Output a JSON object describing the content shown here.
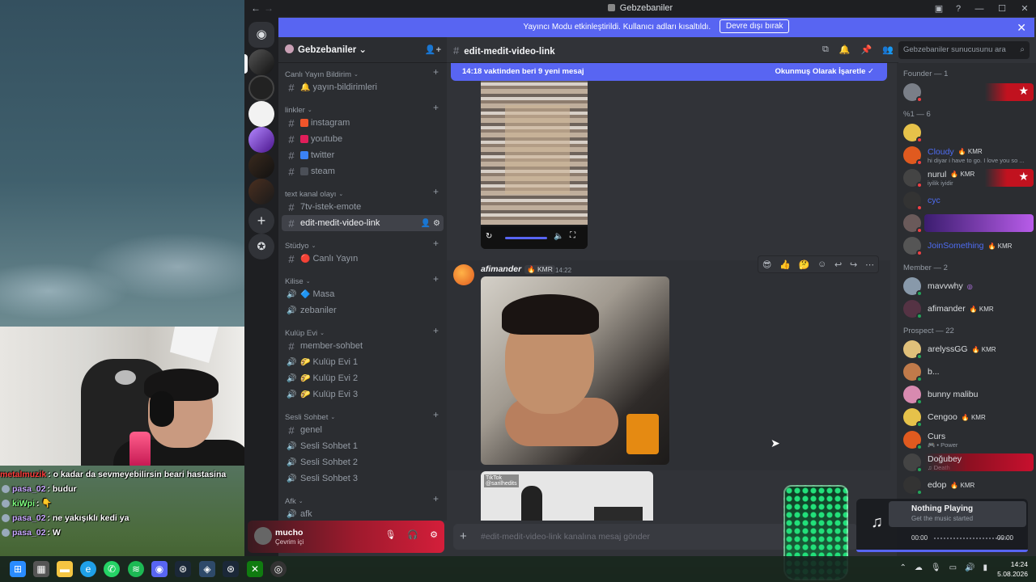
{
  "window": {
    "title": "Gebzebaniler"
  },
  "banner": {
    "text": "Yayıncı Modu etkinleştirildi. Kullanıcı adları kısaltıldı.",
    "button": "Devre dışı bırak"
  },
  "server": {
    "name": "Gebzebaniler",
    "categories": [
      {
        "name": "Canlı Yayın Bildirim",
        "channels": [
          {
            "type": "text",
            "emoji": "🔔",
            "label": "yayın-bildirimleri"
          }
        ]
      },
      {
        "name": "linkler",
        "channels": [
          {
            "type": "text",
            "square": "#f0552b",
            "label": "instagram"
          },
          {
            "type": "text",
            "square": "#e01e5a",
            "label": "youtube"
          },
          {
            "type": "text",
            "square": "#3b82f6",
            "label": "twitter"
          },
          {
            "type": "text",
            "square": "#4b4f57",
            "label": "steam"
          }
        ]
      },
      {
        "name": "text kanal olayı",
        "channels": [
          {
            "type": "text",
            "label": "7tv-istek-emote"
          },
          {
            "type": "text",
            "label": "edit-medit-video-link",
            "active": true
          }
        ]
      },
      {
        "name": "Stüdyo",
        "channels": [
          {
            "type": "text",
            "emoji": "🔴",
            "label": "Canlı Yayın"
          }
        ]
      },
      {
        "name": "Kilise",
        "channels": [
          {
            "type": "voice",
            "emoji": "🔷",
            "label": "Masa"
          },
          {
            "type": "voice",
            "label": "zebaniler"
          }
        ]
      },
      {
        "name": "Kulüp Evi",
        "channels": [
          {
            "type": "text",
            "label": "member-sohbet"
          },
          {
            "type": "voice",
            "emoji": "🌮",
            "label": "Kulüp Evi 1"
          },
          {
            "type": "voice",
            "emoji": "🌮",
            "label": "Kulüp Evi 2"
          },
          {
            "type": "voice",
            "emoji": "🌮",
            "label": "Kulüp Evi 3"
          }
        ]
      },
      {
        "name": "Sesli Sohbet",
        "channels": [
          {
            "type": "text",
            "label": "genel"
          },
          {
            "type": "voice",
            "label": "Sesli Sohbet 1"
          },
          {
            "type": "voice",
            "label": "Sesli Sohbet 2"
          },
          {
            "type": "voice",
            "label": "Sesli Sohbet 3"
          }
        ]
      },
      {
        "name": "Afk",
        "channels": [
          {
            "type": "voice",
            "label": "afk"
          }
        ]
      }
    ]
  },
  "channel": {
    "name": "edit-medit-video-link"
  },
  "search": {
    "placeholder": "Gebzebaniler sunucusunu ara"
  },
  "new_messages": {
    "text": "14:18 vaktinden beri 9 yeni mesaj",
    "action": "Okunmuş Olarak İşaretle"
  },
  "message": {
    "author": "afimander",
    "tag": "KMR",
    "time": "14:22"
  },
  "reactions": [
    "😎",
    "👍",
    "🤔"
  ],
  "tiktok": {
    "logo": "TikTok",
    "handle": "@sarilhedits"
  },
  "input": {
    "placeholder": "#edit-medit-video-link kanalına mesaj gönder"
  },
  "user": {
    "name": "mucho",
    "status": "Çevrim içi"
  },
  "members": {
    "groups": [
      {
        "label": "Founder — 1",
        "items": [
          {
            "name": "",
            "flag": true
          }
        ]
      },
      {
        "label": "%1 — 6",
        "items": [
          {
            "name": "",
            "blue": true
          },
          {
            "name": "Cloudy",
            "tag": "KMR",
            "sub": "hi diyar i have to go. I love you so ...",
            "blue": true
          },
          {
            "name": "nurul",
            "tag": "KMR",
            "sub": "iyilik iyidir",
            "flag": true
          },
          {
            "name": "cyc",
            "blue": true
          },
          {
            "name": "",
            "gradient": true
          },
          {
            "name": "JoinSomething",
            "tag": "KMR",
            "blue": true
          }
        ]
      },
      {
        "label": "Member — 2",
        "items": [
          {
            "name": "mavvwhy",
            "suffix": "◎"
          },
          {
            "name": "afimander",
            "tag": "KMR"
          }
        ]
      },
      {
        "label": "Prospect — 22",
        "items": [
          {
            "name": "arelyssGG",
            "tag": "KMR"
          },
          {
            "name": "b..."
          },
          {
            "name": "bunny malibu"
          },
          {
            "name": "Cengoo",
            "tag": "KMR"
          },
          {
            "name": "Curs",
            "sub": "🎮 • Power"
          },
          {
            "name": "Doğubey",
            "sub": "♫ Death",
            "redgrad": true
          },
          {
            "name": "edop",
            "tag": "KMR"
          }
        ]
      }
    ]
  },
  "music": {
    "title": "Nothing Playing",
    "subtitle": "Get the music started",
    "time_start": "00:00",
    "time_end": "00:00"
  },
  "chat": [
    {
      "user": "metalmuzik",
      "color": "#ff3b3b",
      "msg": ": o kadar da sevmeyebilirsin beari hastasina"
    },
    {
      "user": "pasa_02",
      "color": "#c9a8ff",
      "msg": ": budur"
    },
    {
      "user": "kiWpi",
      "color": "#7fff7f",
      "msg": ": 👇"
    },
    {
      "user": "pasa_02",
      "color": "#c9a8ff",
      "msg": ": ne yakışıklı kedi ya"
    },
    {
      "user": "pasa_02",
      "color": "#c9a8ff",
      "msg": ": W"
    }
  ],
  "clock": {
    "time": "14:24",
    "date": "5.08.2026"
  },
  "colors": {
    "blurple": "#5865f2",
    "bg": "#313338",
    "sidebar": "#2b2d31",
    "rail": "#1e1f22"
  }
}
